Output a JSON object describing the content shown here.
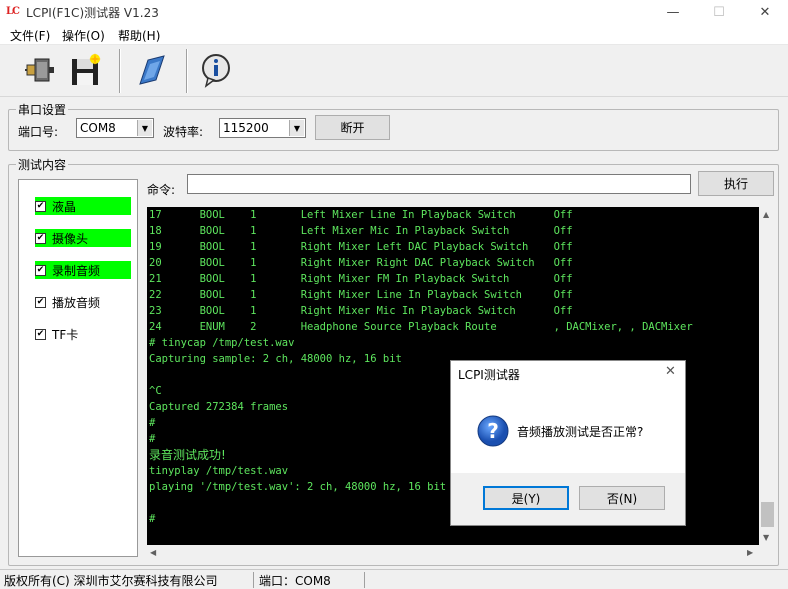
{
  "window": {
    "logo": "LC",
    "title": "LCPI(F1C)测试器 V1.23",
    "controls": {
      "minimize": "—",
      "maximize": "☐",
      "close": "✕"
    }
  },
  "menu": [
    {
      "label": "文件(F)"
    },
    {
      "label": "操作(O)"
    },
    {
      "label": "帮助(H)"
    }
  ],
  "toolbar": {
    "icons": [
      "serial-connect-icon",
      "save-disk-icon",
      "flash-tool-icon",
      "info-icon"
    ]
  },
  "serial": {
    "group_label": "串口设置",
    "port_label": "端口号:",
    "port_value": "COM8",
    "baud_label": "波特率:",
    "baud_value": "115200",
    "disconnect_label": "断开"
  },
  "test": {
    "group_label": "测试内容",
    "items": [
      {
        "label": "液晶",
        "checked": true,
        "passed": true
      },
      {
        "label": "摄像头",
        "checked": true,
        "passed": true
      },
      {
        "label": "录制音频",
        "checked": true,
        "passed": true
      },
      {
        "label": "播放音频",
        "checked": true,
        "passed": false
      },
      {
        "label": "TF卡",
        "checked": true,
        "passed": false
      }
    ],
    "command_label": "命令:",
    "command_value": "",
    "execute_label": "执行"
  },
  "terminal": {
    "lines": [
      {
        "text": "17      BOOL    1       Left Mixer Line In Playback Switch      Off"
      },
      {
        "text": "18      BOOL    1       Left Mixer Mic In Playback Switch       Off"
      },
      {
        "text": "19      BOOL    1       Right Mixer Left DAC Playback Switch    Off"
      },
      {
        "text": "20      BOOL    1       Right Mixer Right DAC Playback Switch   Off"
      },
      {
        "text": "21      BOOL    1       Right Mixer FM In Playback Switch       Off"
      },
      {
        "text": "22      BOOL    1       Right Mixer Line In Playback Switch     Off"
      },
      {
        "text": "23      BOOL    1       Right Mixer Mic In Playback Switch      Off"
      },
      {
        "text": "24      ENUM    2       Headphone Source Playback Route         , DACMixer, , DACMixer"
      },
      {
        "text": "# tinycap /tmp/test.wav"
      },
      {
        "text": "Capturing sample: 2 ch, 48000 hz, 16 bit"
      },
      {
        "text": ""
      },
      {
        "text": "^C"
      },
      {
        "text": "Captured 272384 frames"
      },
      {
        "text": "#"
      },
      {
        "text": "#"
      },
      {
        "text": "录音测试成功!",
        "big": true
      },
      {
        "text": "tinyplay /tmp/test.wav"
      },
      {
        "text": "playing '/tmp/test.wav': 2 ch, 48000 hz, 16 bit"
      },
      {
        "text": ""
      },
      {
        "text": "#"
      }
    ]
  },
  "status": {
    "copyright": "版权所有(C) 深圳市艾尔赛科技有限公司",
    "port": "端口：COM8"
  },
  "dialog": {
    "title": "LCPI测试器",
    "message": "音频播放测试是否正常?",
    "yes_label": "是(Y)",
    "no_label": "否(N)",
    "close": "✕"
  },
  "colors": {
    "pass_highlight": "#00ff00",
    "terminal_bg": "#000000",
    "terminal_text": "#5ee65e",
    "logo": "#dd2222"
  }
}
